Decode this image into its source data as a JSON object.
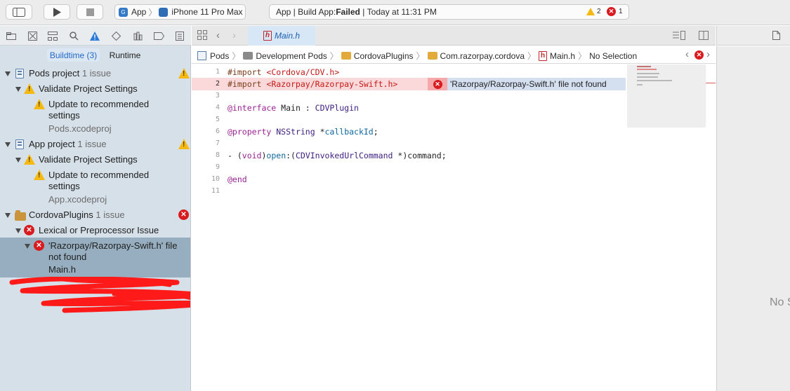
{
  "toolbar": {
    "scheme": {
      "target": "App",
      "device": "iPhone 11 Pro Max"
    },
    "status": {
      "prefix": "App | Build App: ",
      "result": "Failed",
      "time": "Today at 11:31 PM",
      "warnings": "2",
      "errors": "1"
    }
  },
  "navigator": {
    "tabs": {
      "buildtime": "Buildtime (3)",
      "runtime": "Runtime"
    },
    "issues": [
      {
        "title": "Pods project",
        "count": "1 issue"
      },
      {
        "title": "Validate Project Settings"
      },
      {
        "title": "Update to recommended",
        "title2": "settings",
        "file": "Pods.xcodeproj"
      },
      {
        "title": "App project",
        "count": "1 issue"
      },
      {
        "title": "Validate Project Settings"
      },
      {
        "title": "Update to recommended",
        "title2": "settings",
        "file": "App.xcodeproj"
      },
      {
        "title": "CordovaPlugins",
        "count": "1 issue"
      },
      {
        "title": "Lexical or Preprocessor Issue"
      },
      {
        "title": "'Razorpay/Razorpay-Swift.h' file",
        "title2": "not found",
        "file": "Main.h"
      }
    ]
  },
  "editor": {
    "tab": "Main.h",
    "jump_bar": [
      "Pods",
      "Development Pods",
      "CordovaPlugins",
      "Com.razorpay.cordova",
      "Main.h",
      "No Selection"
    ],
    "lines": [
      {
        "n": "1",
        "parts": [
          [
            "kw-pre",
            "#import "
          ],
          [
            "kw-str",
            "<Cordova/CDV.h>"
          ]
        ]
      },
      {
        "n": "2",
        "parts": [
          [
            "kw-pre",
            "#import "
          ],
          [
            "kw-str",
            "<Razorpay/Razorpay-Swift.h>"
          ]
        ]
      },
      {
        "n": "3",
        "parts": []
      },
      {
        "n": "4",
        "parts": [
          [
            "kw-at",
            "@interface"
          ],
          [
            "plain",
            " Main : "
          ],
          [
            "kw-type",
            "CDVPlugin"
          ]
        ]
      },
      {
        "n": "5",
        "parts": []
      },
      {
        "n": "6",
        "parts": [
          [
            "kw-at",
            "@property"
          ],
          [
            "plain",
            " "
          ],
          [
            "kw-type",
            "NSString"
          ],
          [
            "plain",
            " *"
          ],
          [
            "kw-id",
            "callbackId"
          ],
          [
            "plain",
            ";"
          ]
        ]
      },
      {
        "n": "7",
        "parts": []
      },
      {
        "n": "8",
        "parts": [
          [
            "plain",
            "- ("
          ],
          [
            "kw-at",
            "void"
          ],
          [
            "plain",
            ")"
          ],
          [
            "kw-id",
            "open"
          ],
          [
            "plain",
            ":("
          ],
          [
            "kw-type",
            "CDVInvokedUrlCommand"
          ],
          [
            "plain",
            " *)command;"
          ]
        ]
      },
      {
        "n": "9",
        "parts": []
      },
      {
        "n": "10",
        "parts": [
          [
            "kw-at",
            "@end"
          ]
        ]
      },
      {
        "n": "11",
        "parts": []
      }
    ],
    "error_message": "'Razorpay/Razorpay-Swift.h' file not found"
  },
  "inspector": {
    "empty_text": "No S"
  }
}
